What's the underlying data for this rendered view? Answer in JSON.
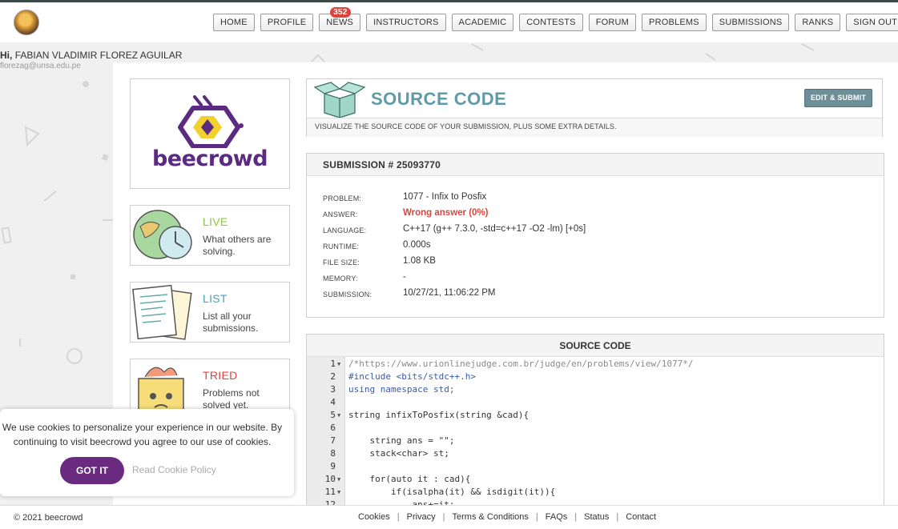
{
  "nav": {
    "items": [
      "HOME",
      "PROFILE",
      "NEWS",
      "INSTRUCTORS",
      "ACADEMIC",
      "CONTESTS",
      "FORUM",
      "PROBLEMS",
      "SUBMISSIONS",
      "RANKS",
      "SIGN OUT"
    ],
    "news_badge": "352"
  },
  "user": {
    "greeting": "Hi,",
    "name": "FABIAN VLADIMIR FLOREZ AGUILAR",
    "email": "florezag@unsa.edu.pe"
  },
  "logo": {
    "text": "beecrowd",
    "color": "#5b2b82",
    "accent": "#f2d12e"
  },
  "side": [
    {
      "title": "LIVE",
      "desc": "What others are solving.",
      "color": "#8cc63f"
    },
    {
      "title": "LIST",
      "desc": "List all your submissions.",
      "color": "#3aa3c4"
    },
    {
      "title": "TRIED",
      "desc": "Problems not solved yet.",
      "color": "#e0433b"
    }
  ],
  "header": {
    "title": "SOURCE CODE",
    "subtitle": "VISUALIZE THE SOURCE CODE OF YOUR SUBMISSION, PLUS SOME EXTRA DETAILS.",
    "edit_button": "EDIT & SUBMIT"
  },
  "submission": {
    "heading": "SUBMISSION # 25093770",
    "rows": [
      {
        "label": "PROBLEM:",
        "value": "1077 - Infix to Posfix"
      },
      {
        "label": "ANSWER:",
        "value": "Wrong answer (0%)"
      },
      {
        "label": "LANGUAGE:",
        "value": "C++17 (g++ 7.3.0, -std=c++17 -O2 -lm) [+0s]"
      },
      {
        "label": "RUNTIME:",
        "value": "0.000s"
      },
      {
        "label": "FILE SIZE:",
        "value": "1.08 KB"
      },
      {
        "label": "MEMORY:",
        "value": "-"
      },
      {
        "label": "SUBMISSION:",
        "value": "10/27/21, 11:06:22 PM"
      }
    ],
    "answer_color": "#d9463e"
  },
  "code": {
    "heading": "SOURCE CODE",
    "lines": [
      {
        "n": "1",
        "fold": true,
        "text": "/*https://www.urionlinejudge.com.br/judge/en/problems/view/1077*/"
      },
      {
        "n": "2",
        "fold": false,
        "text": "#include <bits/stdc++.h>"
      },
      {
        "n": "3",
        "fold": false,
        "text": "using namespace std;"
      },
      {
        "n": "4",
        "fold": false,
        "text": ""
      },
      {
        "n": "5",
        "fold": true,
        "text": "string infixToPosfix(string &cad){"
      },
      {
        "n": "6",
        "fold": false,
        "text": ""
      },
      {
        "n": "7",
        "fold": false,
        "text": "    string ans = \"\";"
      },
      {
        "n": "8",
        "fold": false,
        "text": "    stack<char> st;"
      },
      {
        "n": "9",
        "fold": false,
        "text": ""
      },
      {
        "n": "10",
        "fold": true,
        "text": "    for(auto it : cad){"
      },
      {
        "n": "11",
        "fold": true,
        "text": "        if(isalpha(it) && isdigit(it)){"
      },
      {
        "n": "12",
        "fold": false,
        "text": "            ans+=it;"
      }
    ]
  },
  "cookie": {
    "text": "We use cookies to personalize your experience in our website. By continuing to visit beecrowd you agree to our use of cookies.",
    "button": "GOT IT",
    "link": "Read Cookie Policy"
  },
  "footer": {
    "copyright": "© 2021 beecrowd",
    "links": [
      "Cookies",
      "Privacy",
      "Terms & Conditions",
      "FAQs",
      "Status",
      "Contact"
    ]
  }
}
